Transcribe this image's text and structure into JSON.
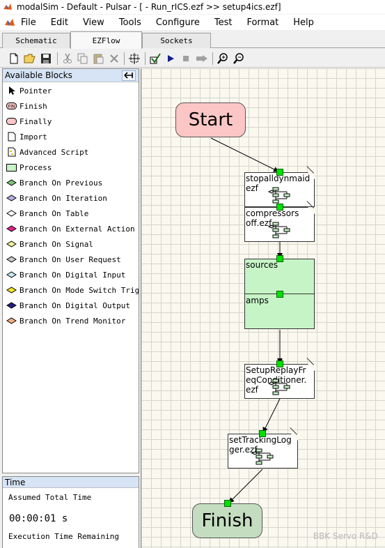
{
  "window": {
    "title": "modalSim - Default - Pulsar - [ - Run_rICS.ezf >> setup4ics.ezf]",
    "icon": "matlab-icon"
  },
  "menu": {
    "items": [
      "File",
      "Edit",
      "View",
      "Tools",
      "Configure",
      "Test",
      "Format",
      "Help"
    ]
  },
  "tabs": {
    "items": [
      "Schematic",
      "EZFlow",
      "Sockets"
    ],
    "active": "EZFlow"
  },
  "toolbar": {
    "buttons": [
      "new-icon",
      "open-icon",
      "save-icon",
      "cut-icon",
      "copy-icon",
      "paste-icon",
      "delete-icon",
      "fit-icon",
      "check-icon",
      "run-icon",
      "stop-icon",
      "step-icon",
      "zoom-in-icon",
      "zoom-out-icon"
    ]
  },
  "available_blocks": {
    "title": "Available Blocks",
    "items": [
      {
        "label": "Pointer",
        "icon": "pointer-icon"
      },
      {
        "label": "Finish",
        "icon": "finish-icon"
      },
      {
        "label": "Finally",
        "icon": "finally-icon"
      },
      {
        "label": "Import",
        "icon": "import-icon"
      },
      {
        "label": "Advanced Script",
        "icon": "script-icon"
      },
      {
        "label": "Process",
        "icon": "process-icon"
      },
      {
        "label": "Branch On Previous",
        "icon": "diamond-icon",
        "color": "#7bc47b"
      },
      {
        "label": "Branch On Iteration",
        "icon": "diamond-icon",
        "color": "#b8b0e8"
      },
      {
        "label": "Branch On Table",
        "icon": "diamond-icon",
        "color": "#ffffff"
      },
      {
        "label": "Branch On External Action",
        "icon": "diamond-icon",
        "color": "#e8208a"
      },
      {
        "label": "Branch On Signal",
        "icon": "diamond-icon",
        "color": "#f4f0a0"
      },
      {
        "label": "Branch On User Request",
        "icon": "diamond-icon",
        "color": "#c8c8c8"
      },
      {
        "label": "Branch On Digital Input",
        "icon": "diamond-icon",
        "color": "#c8e8f4"
      },
      {
        "label": "Branch On Mode Switch Trigger",
        "icon": "diamond-icon",
        "color": "#f4e820"
      },
      {
        "label": "Branch On Digital Output",
        "icon": "diamond-icon",
        "color": "#202080"
      },
      {
        "label": "Branch On Trend Monitor",
        "icon": "diamond-icon",
        "color": "#f4b080"
      }
    ]
  },
  "time_panel": {
    "title": "Time",
    "assumed_label": "Assumed Total Time",
    "assumed_value": "00:00:01 s",
    "remaining_label": "Execution Time Remaining"
  },
  "flow": {
    "start": "Start",
    "finish": "Finish",
    "node1_line1": "stopalldynmaid",
    "node1_line2": "ezf",
    "node2_line1": "compressors",
    "node2_line2": "off.ezf",
    "process_top": "sources",
    "process_bottom": "amps",
    "node3_line1": "SetupReplayFr",
    "node3_line2": "eqConditioner.",
    "node3_line3": "ezf",
    "node4_line1": "setTrackingLog",
    "node4_line2": "ger.ezf",
    "watermark": "BBK Servo R&D"
  },
  "colors": {
    "start_fill": "#fcc6c6",
    "finish_fill": "#c4ddc0",
    "process_fill": "#c6f4c6",
    "port": "#00e000",
    "panel_header": "#d6e4f5"
  }
}
